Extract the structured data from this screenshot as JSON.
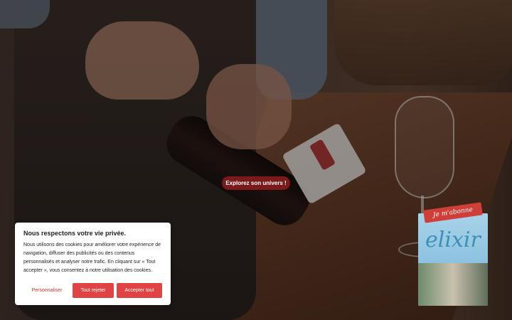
{
  "hero": {
    "cta_label": "Explorez son univers !"
  },
  "promo": {
    "badge": "Je m'abonne",
    "magazine_title": "elixir"
  },
  "cookie_banner": {
    "title": "Nous respectons votre vie privée.",
    "text": "Nous utilisons des cookies pour améliorer votre expérience de navigation, diffuser des publicités ou des contenus personnalisés et analyser notre trafic. En cliquant sur « Tout accepter », vous consentez à notre utilisation des cookies.",
    "customize_label": "Personnaliser",
    "reject_label": "Tout rejeter",
    "accept_label": "Accepter tout"
  },
  "colors": {
    "accent": "#e04343",
    "cta_bg": "#7a1a1a"
  }
}
